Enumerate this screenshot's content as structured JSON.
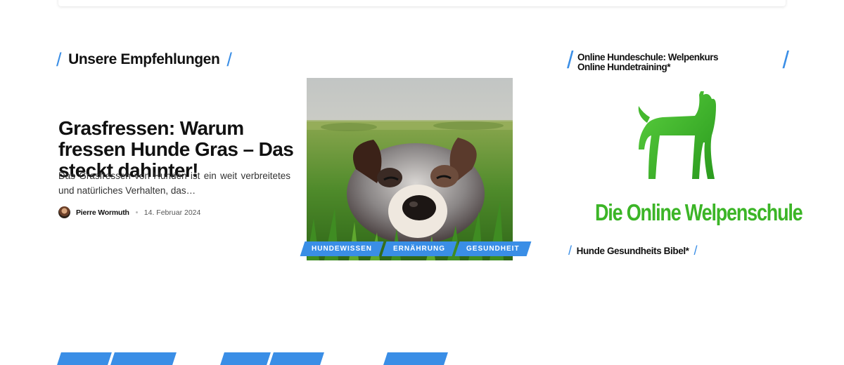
{
  "section": {
    "title": "Unsere Empfehlungen"
  },
  "article": {
    "title": "Grasfressen: Warum fressen Hunde Gras – Das steckt dahinter!",
    "excerpt": "Das Grasfressen von Hunden ist ein weit verbreitetes und natürliches Verhalten, das…",
    "author": "Pierre Wormuth",
    "date": "14. Februar 2024",
    "categories": [
      "Hundewissen",
      "Ernährung",
      "Gesundheit"
    ]
  },
  "sidebar": {
    "title": "Online Hundeschule: Welpenkurs Online Hundetraining*",
    "ad_logo_text": "Die Online Welpenschule",
    "link": "Hunde Gesundheits Bibel*"
  },
  "colors": {
    "accent": "#3a8ee6",
    "logo_green": "#3cb527"
  }
}
